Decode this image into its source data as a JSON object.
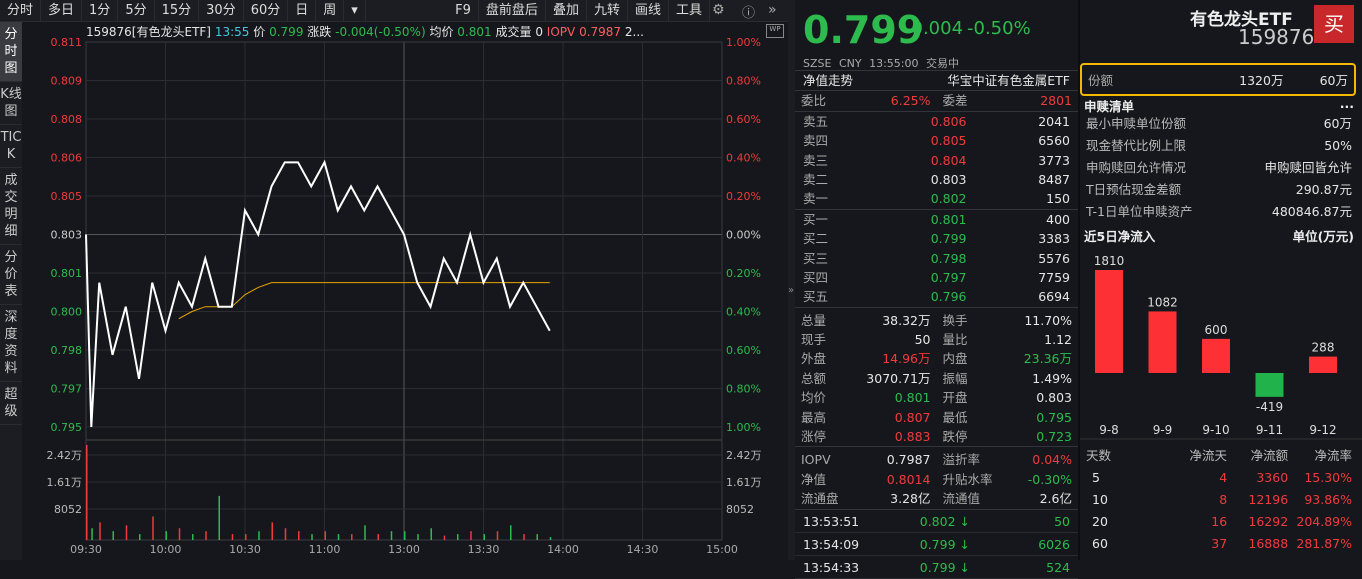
{
  "toolbar": {
    "left": [
      "分时",
      "多日",
      "1分",
      "5分",
      "15分",
      "30分",
      "60分",
      "日",
      "周",
      "▾"
    ],
    "right": [
      "F9",
      "盘前盘后",
      "叠加",
      "九转",
      "画线",
      "工具"
    ]
  },
  "vtabs": [
    "分时图",
    "K线图",
    "TICK",
    "成交明细",
    "分价表",
    "深度资料",
    "超级"
  ],
  "infoline": {
    "code": "159876[有色龙头ETF]",
    "time": "13:55",
    "price_label": "价",
    "price": "0.799",
    "chg_label": "涨跌",
    "chg": "-0.004(-0.50%)",
    "avg_label": "均价",
    "avg": "0.801",
    "vol_label": "成交量",
    "vol": "0",
    "iopv_label": "IOPV",
    "iopv": "0.7987",
    "more": "2..."
  },
  "chart_data": {
    "type": "line",
    "title": "分时图",
    "price_ticks": [
      "0.811",
      "0.809",
      "0.808",
      "0.806",
      "0.805",
      "0.803",
      "0.801",
      "0.800",
      "0.798",
      "0.797",
      "0.795"
    ],
    "pct_ticks": [
      "1.00%",
      "0.80%",
      "0.60%",
      "0.40%",
      "0.20%",
      "0.00%",
      "0.20%",
      "0.40%",
      "0.60%",
      "0.80%",
      "1.00%"
    ],
    "ylim": [
      0.795,
      0.811
    ],
    "prev_close": 0.803,
    "vol_ticks": [
      "2.42万",
      "1.61万",
      "8052"
    ],
    "x_ticks": [
      "09:30",
      "10:00",
      "10:30",
      "11:00",
      "13:00",
      "13:30",
      "14:00",
      "14:30",
      "15:00"
    ],
    "minutes": [
      0,
      2,
      5,
      10,
      15,
      20,
      25,
      30,
      35,
      40,
      45,
      50,
      55,
      60,
      65,
      70,
      75,
      80,
      85,
      90,
      95,
      100,
      105,
      110,
      115,
      120,
      125,
      130,
      135,
      140,
      145,
      150,
      155,
      160,
      165,
      170,
      175
    ],
    "price": [
      0.803,
      0.795,
      0.801,
      0.798,
      0.8,
      0.797,
      0.801,
      0.799,
      0.801,
      0.8,
      0.802,
      0.8,
      0.8,
      0.804,
      0.803,
      0.805,
      0.806,
      0.806,
      0.805,
      0.806,
      0.804,
      0.805,
      0.804,
      0.805,
      0.804,
      0.803,
      0.801,
      0.8,
      0.802,
      0.801,
      0.803,
      0.801,
      0.802,
      0.8,
      0.801,
      0.8,
      0.799
    ],
    "avg": [
      null,
      null,
      null,
      null,
      null,
      null,
      null,
      null,
      0.7995,
      0.7998,
      0.8,
      0.8,
      0.8,
      0.8005,
      0.8008,
      0.801,
      0.801,
      0.801,
      0.801,
      0.801,
      0.801,
      0.801,
      0.801,
      0.801,
      0.801,
      0.801,
      0.801,
      0.801,
      0.801,
      0.801,
      0.801,
      0.801,
      0.801,
      0.801,
      0.801,
      0.801,
      0.801
    ],
    "volume": [
      32300,
      4000,
      6000,
      3000,
      5000,
      2000,
      8000,
      3000,
      4000,
      2000,
      3000,
      15000,
      2000,
      2000,
      3000,
      6000,
      4000,
      3000,
      2000,
      3000,
      2000,
      2000,
      5000,
      2000,
      3000,
      3000,
      2000,
      4000,
      1500,
      2000,
      3000,
      2000,
      3000,
      5000,
      2000,
      2000,
      1000
    ]
  },
  "quote": {
    "price": "0.799",
    "chg": "-0.004",
    "pct": "-0.50%",
    "name": "有色龙头ETF",
    "code": "159876",
    "buy_btn": "买",
    "exchange": "SZSE",
    "currency": "CNY",
    "time": "13:55:00",
    "status": "交易中"
  },
  "nav": {
    "label": "净值走势",
    "index": "华宝中证有色金属ETF"
  },
  "wei": {
    "wb_label": "委比",
    "wb": "6.25%",
    "wc_label": "委差",
    "wc": "2801"
  },
  "asks": [
    {
      "l": "卖五",
      "p": "0.806",
      "v": "2041",
      "c": "r"
    },
    {
      "l": "卖四",
      "p": "0.805",
      "v": "6560",
      "c": "r"
    },
    {
      "l": "卖三",
      "p": "0.804",
      "v": "3773",
      "c": "r"
    },
    {
      "l": "卖二",
      "p": "0.803",
      "v": "8487",
      "c": "w"
    },
    {
      "l": "卖一",
      "p": "0.802",
      "v": "150",
      "c": "g"
    }
  ],
  "bids": [
    {
      "l": "买一",
      "p": "0.801",
      "v": "400",
      "c": "g"
    },
    {
      "l": "买二",
      "p": "0.799",
      "v": "3383",
      "c": "g"
    },
    {
      "l": "买三",
      "p": "0.798",
      "v": "5576",
      "c": "g"
    },
    {
      "l": "买四",
      "p": "0.797",
      "v": "7759",
      "c": "g"
    },
    {
      "l": "买五",
      "p": "0.796",
      "v": "6694",
      "c": "g"
    }
  ],
  "stats": [
    [
      [
        "总量",
        "38.32万",
        "w"
      ],
      [
        "换手",
        "11.70%",
        "w"
      ]
    ],
    [
      [
        "现手",
        "50",
        "w"
      ],
      [
        "量比",
        "1.12",
        "w"
      ]
    ],
    [
      [
        "外盘",
        "14.96万",
        "r"
      ],
      [
        "内盘",
        "23.36万",
        "g"
      ]
    ],
    [
      [
        "总额",
        "3070.71万",
        "w"
      ],
      [
        "振幅",
        "1.49%",
        "w"
      ]
    ],
    [
      [
        "均价",
        "0.801",
        "g"
      ],
      [
        "开盘",
        "0.803",
        "w"
      ]
    ],
    [
      [
        "最高",
        "0.807",
        "r"
      ],
      [
        "最低",
        "0.795",
        "g"
      ]
    ],
    [
      [
        "涨停",
        "0.883",
        "r"
      ],
      [
        "跌停",
        "0.723",
        "g"
      ]
    ]
  ],
  "etf": [
    [
      [
        "IOPV",
        "0.7987",
        "w"
      ],
      [
        "溢折率",
        "0.04%",
        "r"
      ]
    ],
    [
      [
        "净值",
        "0.8014",
        "r"
      ],
      [
        "升贴水率",
        "-0.30%",
        "g"
      ]
    ],
    [
      [
        "流通盘",
        "3.28亿",
        "w"
      ],
      [
        "流通值",
        "2.6亿",
        "w"
      ]
    ]
  ],
  "ticks": [
    {
      "t": "13:53:51",
      "p": "0.802",
      "v": "50"
    },
    {
      "t": "13:54:09",
      "p": "0.799",
      "v": "6026"
    },
    {
      "t": "13:54:33",
      "p": "0.799",
      "v": "524"
    }
  ],
  "share": {
    "label": "份额",
    "v1": "1320万",
    "v2": "60万"
  },
  "redeem": {
    "title": "申赎清单",
    "more": "...",
    "rows": [
      [
        "最小申赎单位份额",
        "60万"
      ],
      [
        "现金替代比例上限",
        "50%"
      ],
      [
        "申购赎回允许情况",
        "申购赎回皆允许"
      ],
      [
        "T日预估现金差额",
        "290.87元"
      ],
      [
        "T-1日单位申赎资产",
        "480846.87元"
      ]
    ]
  },
  "flow": {
    "title": "近5日净流入",
    "unit": "单位(万元)",
    "dates": [
      "9-8",
      "9-9",
      "9-10",
      "9-11",
      "9-12"
    ],
    "values": [
      1810,
      1082,
      600,
      -419,
      288
    ],
    "labels": [
      "1810",
      "1082",
      "600",
      "-419",
      "288"
    ]
  },
  "flowtable": {
    "headers": [
      "天数",
      "净流天",
      "净流额",
      "净流率"
    ],
    "rows": [
      [
        "5",
        "4",
        "3360",
        "15.30%"
      ],
      [
        "10",
        "8",
        "12196",
        "93.86%"
      ],
      [
        "20",
        "16",
        "16292",
        "204.89%"
      ],
      [
        "60",
        "37",
        "16888",
        "281.87%"
      ]
    ]
  }
}
